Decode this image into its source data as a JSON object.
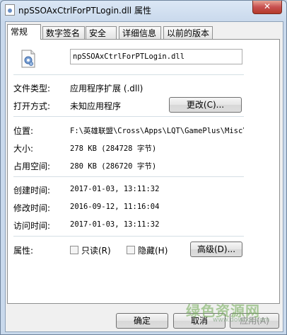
{
  "window": {
    "title": "npSSOAxCtrlForPTLogin.dll 属性",
    "close": "✕"
  },
  "tabs": [
    {
      "label": "常规"
    },
    {
      "label": "数字签名"
    },
    {
      "label": "安全"
    },
    {
      "label": "详细信息"
    },
    {
      "label": "以前的版本"
    }
  ],
  "general": {
    "filename": "npSSOAxCtrlForPTLogin.dll www.downcc.com",
    "file_type_label": "文件类型:",
    "file_type_value": "应用程序扩展 (.dll)",
    "open_with_label": "打开方式:",
    "open_with_value": "未知应用程序",
    "change_button": "更改(C)...",
    "location_label": "位置:",
    "location_value": "F:\\英雄联盟\\Cross\\Apps\\LQT\\GamePlus\\Misc\\",
    "size_label": "大小:",
    "size_value": "278 KB (284728 字节)",
    "disk_size_label": "占用空间:",
    "disk_size_value": "280 KB (286720 字节)",
    "created_label": "创建时间:",
    "created_value": "2017-01-03, 13:11:32",
    "modified_label": "修改时间:",
    "modified_value": "2016-09-12, 11:16:04",
    "accessed_label": "访问时间:",
    "accessed_value": "2017-01-03, 13:11:32",
    "attributes_label": "属性:",
    "readonly_label": "只读(R)",
    "hidden_label": "隐藏(H)",
    "advanced_button": "高级(D)..."
  },
  "footer": {
    "ok": "确定",
    "cancel": "取消",
    "apply": "应用(A)"
  },
  "watermark": {
    "text": "绿色资源网",
    "sub": "www.downcc.com"
  }
}
